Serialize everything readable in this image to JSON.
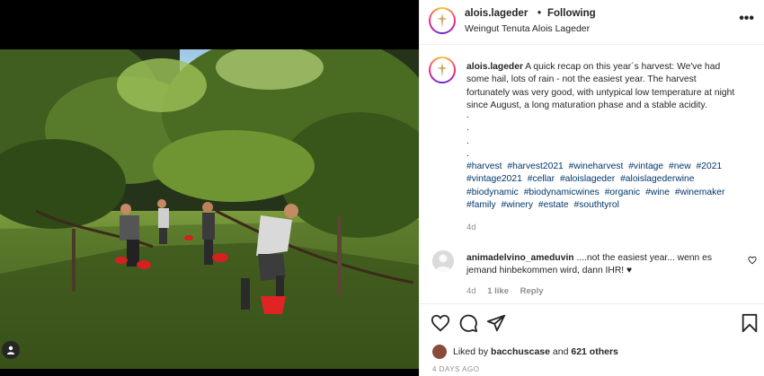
{
  "post": {
    "username": "alois.lageder",
    "separator": "•",
    "follow_status": "Following",
    "location": "Weingut Tenuta Alois Lageder",
    "more_label": "•••"
  },
  "caption": {
    "username": "alois.lageder",
    "text": "A quick recap on this year´s harvest: We've had some hail, lots of rain - not the easiest year. The harvest fortunately was very good, with untypical low temperature at night since August, a long maturation phase and a stable acidity.",
    "dots": [
      ".",
      ".",
      ".",
      "."
    ],
    "hashtags": [
      "#harvest",
      "#harvest2021",
      "#wineharvest",
      "#vintage",
      "#new",
      "#2021",
      "#vintage2021",
      "#cellar",
      "#aloislageder",
      "#aloislagederwine",
      "#biodynamic",
      "#biodynamicwines",
      "#organic",
      "#wine",
      "#winemaker",
      "#family",
      "#winery",
      "#estate",
      "#southtyrol"
    ],
    "time": "4d"
  },
  "comment": {
    "username": "animadelvino_ameduvin",
    "text": "....not the easiest year... wenn es jemand hinbekommen wird, dann IHR! ♥",
    "time": "4d",
    "likes": "1 like",
    "reply": "Reply"
  },
  "likes": {
    "prefix": "Liked by",
    "user": "bacchuscase",
    "joiner": "and",
    "others": "621 others"
  },
  "date": "4 DAYS AGO",
  "icons": {
    "like": "heart-icon",
    "comment": "comment-icon",
    "share": "share-icon",
    "save": "bookmark-icon",
    "tags": "user-icon"
  },
  "colors": {
    "link": "#00376b",
    "muted": "#8e8e8e",
    "text": "#262626"
  }
}
